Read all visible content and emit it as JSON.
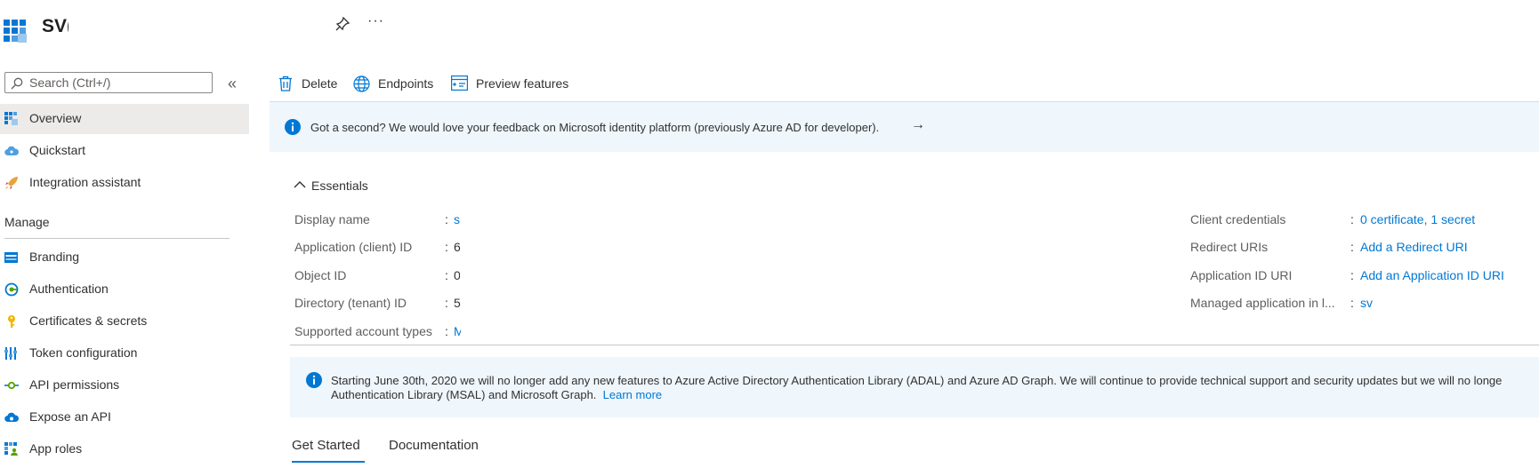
{
  "header": {
    "title": "SV(",
    "more_label": "···"
  },
  "search": {
    "placeholder": "Search (Ctrl+/)",
    "collapse_label": "«"
  },
  "sidebar": {
    "items_top": [
      {
        "label": "Overview"
      },
      {
        "label": "Quickstart"
      },
      {
        "label": "Integration assistant"
      }
    ],
    "section_manage": "Manage",
    "items_manage": [
      {
        "label": "Branding"
      },
      {
        "label": "Authentication"
      },
      {
        "label": "Certificates & secrets"
      },
      {
        "label": "Token configuration"
      },
      {
        "label": "API permissions"
      },
      {
        "label": "Expose an API"
      },
      {
        "label": "App roles"
      }
    ]
  },
  "toolbar": {
    "delete_label": "Delete",
    "endpoints_label": "Endpoints",
    "preview_label": "Preview features"
  },
  "feedback_banner": {
    "text": "Got a second? We would love your feedback on Microsoft identity platform (previously Azure AD for developer).",
    "arrow": "→"
  },
  "essentials": {
    "title": "Essentials",
    "left": [
      {
        "label": "Display name",
        "value": "s"
      },
      {
        "label": "Application (client) ID",
        "value": "6"
      },
      {
        "label": "Object ID",
        "value": "0"
      },
      {
        "label": "Directory (tenant) ID",
        "value": "5"
      },
      {
        "label": "Supported account types",
        "value": "M"
      }
    ],
    "right": [
      {
        "label": "Client credentials",
        "value": "0 certificate, 1 secret"
      },
      {
        "label": "Redirect URIs",
        "value": "Add a Redirect URI"
      },
      {
        "label": "Application ID URI",
        "value": "Add an Application ID URI"
      },
      {
        "label": "Managed application in l...",
        "value": "sv"
      }
    ]
  },
  "deprecation_banner": {
    "line1": "Starting June 30th, 2020 we will no longer add any new features to Azure Active Directory Authentication Library (ADAL) and Azure AD Graph. We will continue to provide technical support and security updates but we will no longe",
    "line2": "Authentication Library (MSAL) and Microsoft Graph.",
    "learn_more": "Learn more"
  },
  "tabs": [
    {
      "label": "Get Started"
    },
    {
      "label": "Documentation"
    }
  ],
  "colors": {
    "accent": "#0078d4",
    "banner_bg": "#eff6fc",
    "active_nav_bg": "#edebe9"
  }
}
